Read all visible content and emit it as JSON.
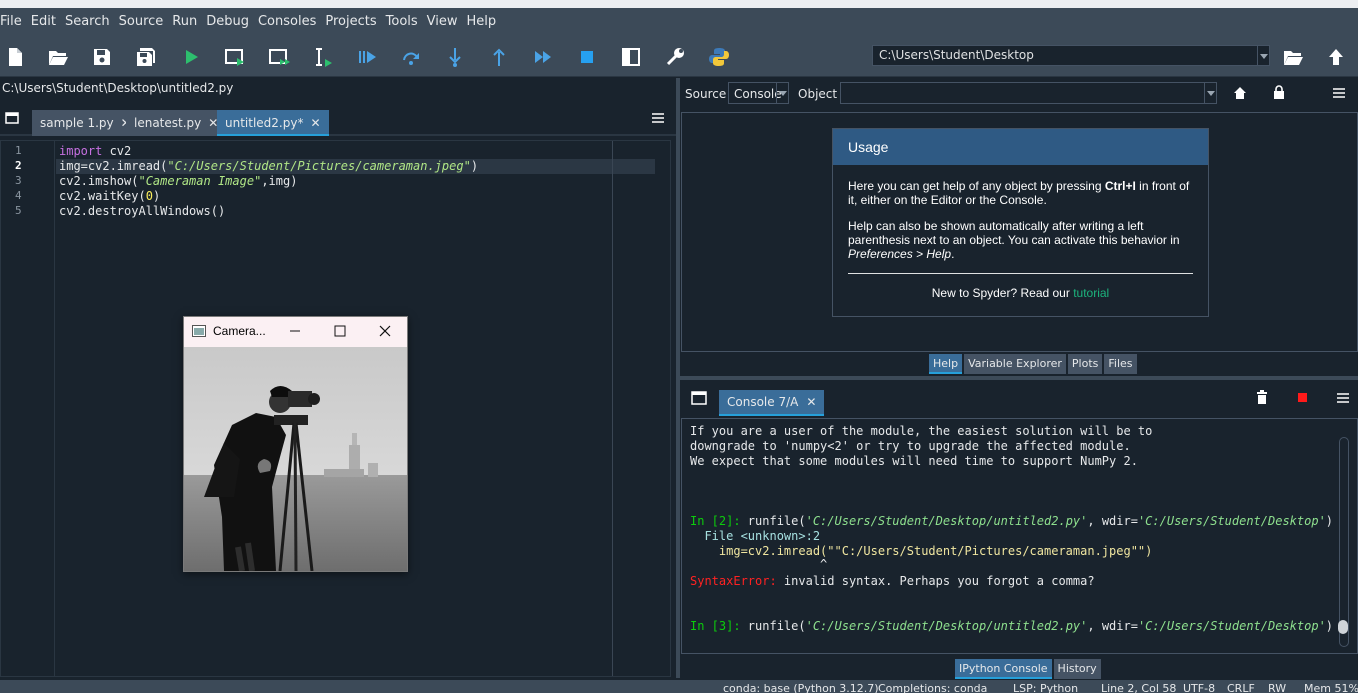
{
  "menu": [
    "File",
    "Edit",
    "Search",
    "Source",
    "Run",
    "Debug",
    "Consoles",
    "Projects",
    "Tools",
    "View",
    "Help"
  ],
  "toolbar": {
    "working_dir": "C:\\Users\\Student\\Desktop",
    "icons": [
      "new-file-icon",
      "open-file-icon",
      "save-icon",
      "save-all-icon",
      "run-icon",
      "run-cell-icon",
      "run-cell-advance-icon",
      "run-selection-icon",
      "debug-icon",
      "step-icon",
      "step-into-icon",
      "step-return-icon",
      "continue-icon",
      "stop-icon",
      "maximize-pane-icon",
      "preferences-icon",
      "python-path-icon",
      "browse-dir-icon",
      "parent-dir-icon"
    ]
  },
  "editor": {
    "filepath": "C:\\Users\\Student\\Desktop\\untitled2.py",
    "tabs": [
      {
        "label": "sample 1.py",
        "active": false
      },
      {
        "label": "lenatest.py",
        "active": false
      },
      {
        "label": "untitled2.py*",
        "active": true
      }
    ],
    "line_numbers": [
      "1",
      "2",
      "3",
      "4",
      "5"
    ],
    "current_line": 2,
    "code": {
      "l1_kw": "import",
      "l1_rest": " cv2",
      "l2_pre": "img=cv2.imread(",
      "l2_str": "\"C:/Users/Student/Pictures/cameraman.jpeg\"",
      "l2_post": ")",
      "l3_pre": "cv2.imshow(",
      "l3_str": "\"Cameraman Image\"",
      "l3_post": ",img)",
      "l4_pre": "cv2.waitKey(",
      "l4_num": "0",
      "l4_post": ")",
      "l5": "cv2.destroyAllWindows()"
    }
  },
  "image_window": {
    "title": "Camera..."
  },
  "help": {
    "source_label": "Source",
    "source_value": "Console",
    "object_label": "Object",
    "object_value": "",
    "usage_title": "Usage",
    "p1_a": "Here you can get help of any object by pressing ",
    "p1_b": "Ctrl+I",
    "p1_c": " in front of it, either on the Editor or the Console.",
    "p2_a": "Help can also be shown automatically after writing a left parenthesis next to an object. You can activate this behavior in ",
    "p2_b": "Preferences > Help",
    "p2_c": ".",
    "p3_a": "New to Spyder? Read our ",
    "p3_link": "tutorial",
    "tabs": [
      "Help",
      "Variable Explorer",
      "Plots",
      "Files"
    ],
    "active_tab": "Help"
  },
  "console": {
    "tab": "Console 7/A",
    "line1": "If you are a user of the module, the easiest solution will be to",
    "line2": "downgrade to 'numpy<2' or try to upgrade the affected module.",
    "line3": "We expect that some modules will need time to support NumPy 2.",
    "in2_prompt": "In [2]:",
    "in2_a": " runfile(",
    "in2_s1": "'C:/Users/Student/Desktop/untitled2.py'",
    "in2_b": ", wdir=",
    "in2_s2": "'C:/Users/Student/Desktop'",
    "in2_c": ")",
    "file_line": "  File ",
    "file_name": "<unknown>:2",
    "err_code": "    img=cv2.imread(\"\"C:/Users/Student/Pictures/cameraman.jpeg\"\")",
    "caret": "                  ^",
    "err_type": "SyntaxError:",
    "err_msg": " invalid syntax. Perhaps you forgot a comma?",
    "in3_prompt": "In [3]:",
    "in3_a": " runfile(",
    "in3_s1": "'C:/Users/Student/Desktop/untitled2.py'",
    "in3_b": ", wdir=",
    "in3_s2": "'C:/Users/Student/Desktop'",
    "in3_c": ")",
    "tabs": [
      "IPython Console",
      "History"
    ],
    "active_tab": "IPython Console"
  },
  "status": {
    "conda": "conda: base (Python 3.12.7)",
    "completions": "Completions: conda",
    "lsp": "LSP: Python",
    "position": "Line 2, Col 58",
    "encoding": "UTF-8",
    "eol": "CRLF",
    "rw": "RW",
    "mem": "Mem 51%"
  },
  "colors": {
    "background": "#19232d",
    "bar": "#3c4a58",
    "active_tab": "#3a6d99",
    "usage_header": "#2f5a84"
  }
}
